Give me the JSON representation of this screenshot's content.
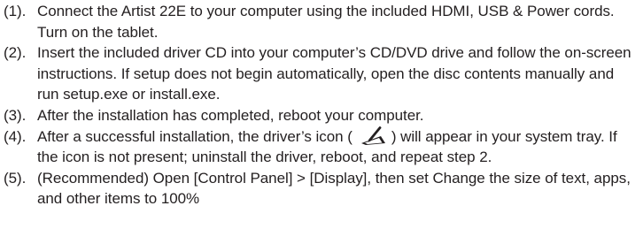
{
  "steps": [
    {
      "number": "(1).",
      "text": "Connect the Artist 22E to your computer using the included HDMI, USB & Power cords. Turn on the tablet."
    },
    {
      "number": "(2).",
      "text": "Insert the included driver CD into your computer’s CD/DVD drive and follow the on-screen instructions. If setup does not begin automatically, open the disc contents manually and run setup.exe or install.exe."
    },
    {
      "number": "(3).",
      "text": "After the installation has completed, reboot your computer."
    },
    {
      "number": "(4).",
      "text_before_icon": "After a successful installation, the driver’s icon (",
      "icon": "tablet-pen-icon",
      "text_after_icon": ") will appear in your system tray. If the icon is not present; uninstall the driver, reboot, and repeat step 2."
    },
    {
      "number": "(5).",
      "text": "(Recommended) Open [Control Panel] > [Display], then set Change the size of text, apps, and other items to 100%"
    }
  ]
}
